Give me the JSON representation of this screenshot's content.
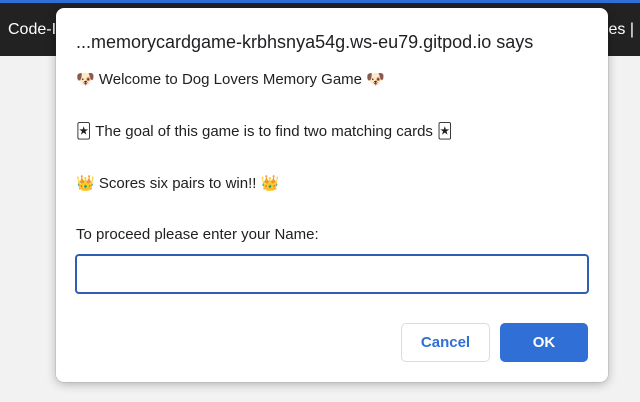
{
  "background": {
    "left_text": "Code-I",
    "right_text": "nes |",
    "bar_color": "#222222",
    "accent_color": "#2f6fd6"
  },
  "dialog": {
    "title": "...memorycardgame-krbhsnya54g.ws-eu79.gitpod.io says",
    "lines": [
      {
        "prefix": "🐶",
        "text": "Welcome to Dog Lovers Memory Game",
        "suffix": "🐶"
      },
      {
        "prefix": "🃏",
        "text": "The goal of this game is to find two matching cards",
        "suffix": "🃏"
      },
      {
        "prefix": "👑",
        "text": "Scores six pairs to win!!",
        "suffix": "👑"
      }
    ],
    "prompt_label": "To proceed please enter your Name:",
    "input": {
      "value": "",
      "placeholder": ""
    },
    "buttons": {
      "cancel": "Cancel",
      "ok": "OK"
    }
  }
}
